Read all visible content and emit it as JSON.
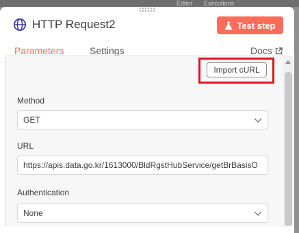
{
  "background": {
    "tabs": [
      "Editor",
      "Executions"
    ]
  },
  "node": {
    "title": "HTTP Request2",
    "icon": "globe-icon",
    "test_button_label": "Test step",
    "test_button_icon": "flask-icon"
  },
  "tabs": [
    {
      "label": "Parameters",
      "active": true
    },
    {
      "label": "Settings",
      "active": false
    }
  ],
  "docs": {
    "label": "Docs",
    "icon": "external-link-icon"
  },
  "import_curl_label": "Import cURL",
  "fields": {
    "method": {
      "label": "Method",
      "value": "GET"
    },
    "url": {
      "label": "URL",
      "value": "https://apis.data.go.kr/1613000/BldRgstHubService/getBrBasisO"
    },
    "authentication": {
      "label": "Authentication",
      "value": "None"
    }
  },
  "colors": {
    "accent": "#ff6d5a",
    "highlight": "#e0141e"
  }
}
